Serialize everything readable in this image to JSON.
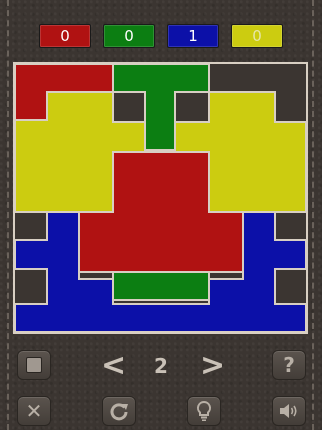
{
  "scores": {
    "red": "0",
    "green": "0",
    "blue": "1",
    "yellow": "0"
  },
  "colors": {
    "red": "#b01212",
    "green": "#0c7e12",
    "blue": "#0c10a8",
    "yellow": "#cccc10",
    "background": "#3b3531",
    "border": "#d8cfc3"
  },
  "level": {
    "number": "2"
  },
  "controls": {
    "menu_icon": "square-icon",
    "prev_glyph": "<",
    "next_glyph": ">",
    "help_glyph": "?",
    "close_glyph": "✕",
    "restart_icon": "restart-icon",
    "hint_icon": "lightbulb-icon",
    "sound_icon": "speaker-icon"
  }
}
